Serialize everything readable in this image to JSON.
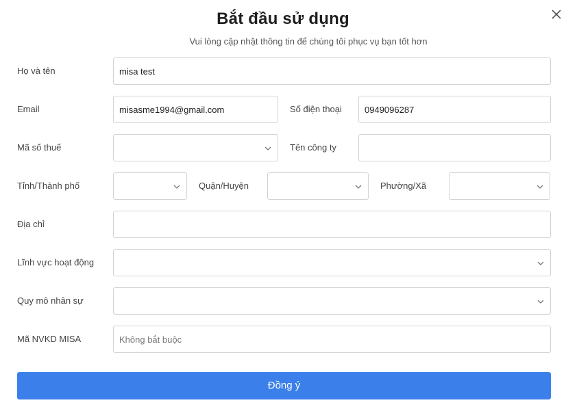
{
  "dialog": {
    "title": "Bắt đầu sử dụng",
    "subtitle": "Vui lòng cập nhật thông tin để chúng tôi phục vụ bạn tốt hơn",
    "close_icon": "close-icon"
  },
  "form": {
    "full_name": {
      "label": "Họ và tên",
      "value": "misa test"
    },
    "email": {
      "label": "Email",
      "value": "misasme1994@gmail.com"
    },
    "phone": {
      "label": "Số điện thoại",
      "value": "0949096287"
    },
    "tax_code": {
      "label": "Mã số thuế",
      "value": "",
      "icon": "chevron-down-icon"
    },
    "company_name": {
      "label": "Tên công ty",
      "value": ""
    },
    "province": {
      "label": "Tỉnh/Thành phố",
      "value": "",
      "icon": "chevron-down-icon"
    },
    "district": {
      "label": "Quận/Huyện",
      "value": "",
      "icon": "chevron-down-icon"
    },
    "ward": {
      "label": "Phường/Xã",
      "value": "",
      "icon": "chevron-down-icon"
    },
    "address": {
      "label": "Địa chỉ",
      "value": ""
    },
    "industry": {
      "label": "Lĩnh vực hoạt động",
      "value": "",
      "icon": "chevron-down-icon"
    },
    "staff_size": {
      "label": "Quy mô nhân sự",
      "value": "",
      "icon": "chevron-down-icon"
    },
    "sales_code": {
      "label": "Mã NVKD MISA",
      "value": "",
      "placeholder": "Không bắt buộc"
    }
  },
  "submit": {
    "label": "Đồng ý"
  },
  "colors": {
    "accent": "#3b80ea",
    "border": "#d3d3d3"
  }
}
